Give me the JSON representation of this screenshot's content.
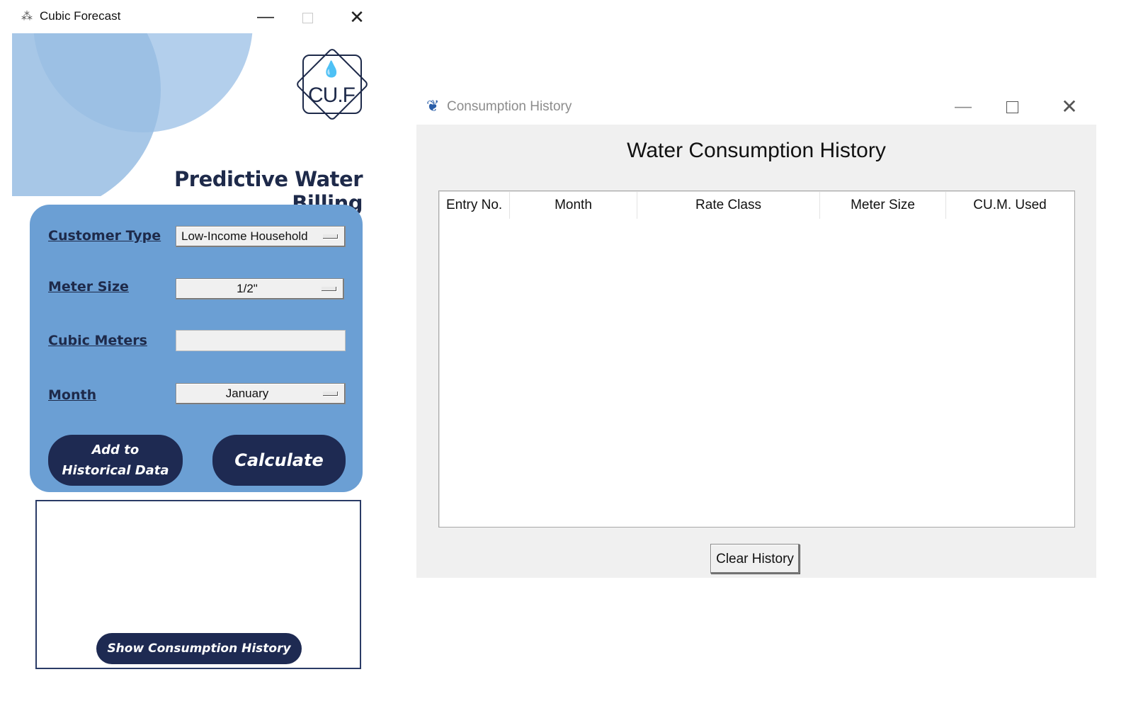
{
  "main_window": {
    "title": "Cubic Forecast",
    "logo_text": "CU.F",
    "heading": "Predictive Water Billing",
    "form": {
      "customer_type_label": "Customer Type",
      "customer_type_value": "Low-Income Household",
      "meter_size_label": "Meter Size",
      "meter_size_value": "1/2\"",
      "cubic_meters_label": "Cubic Meters",
      "cubic_meters_value": "",
      "month_label": "Month",
      "month_value": "January"
    },
    "buttons": {
      "add_historical": "Add to\nHistorical Data",
      "calculate": "Calculate",
      "show_history": "Show Consumption History"
    },
    "colors": {
      "panel": "#6b9fd4",
      "navy": "#1e2a52"
    }
  },
  "history_window": {
    "title": "Consumption History",
    "heading": "Water Consumption History",
    "columns": [
      "Entry No.",
      "Month",
      "Rate Class",
      "Meter Size",
      "CU.M. Used"
    ],
    "rows": [],
    "clear_button": "Clear History"
  }
}
